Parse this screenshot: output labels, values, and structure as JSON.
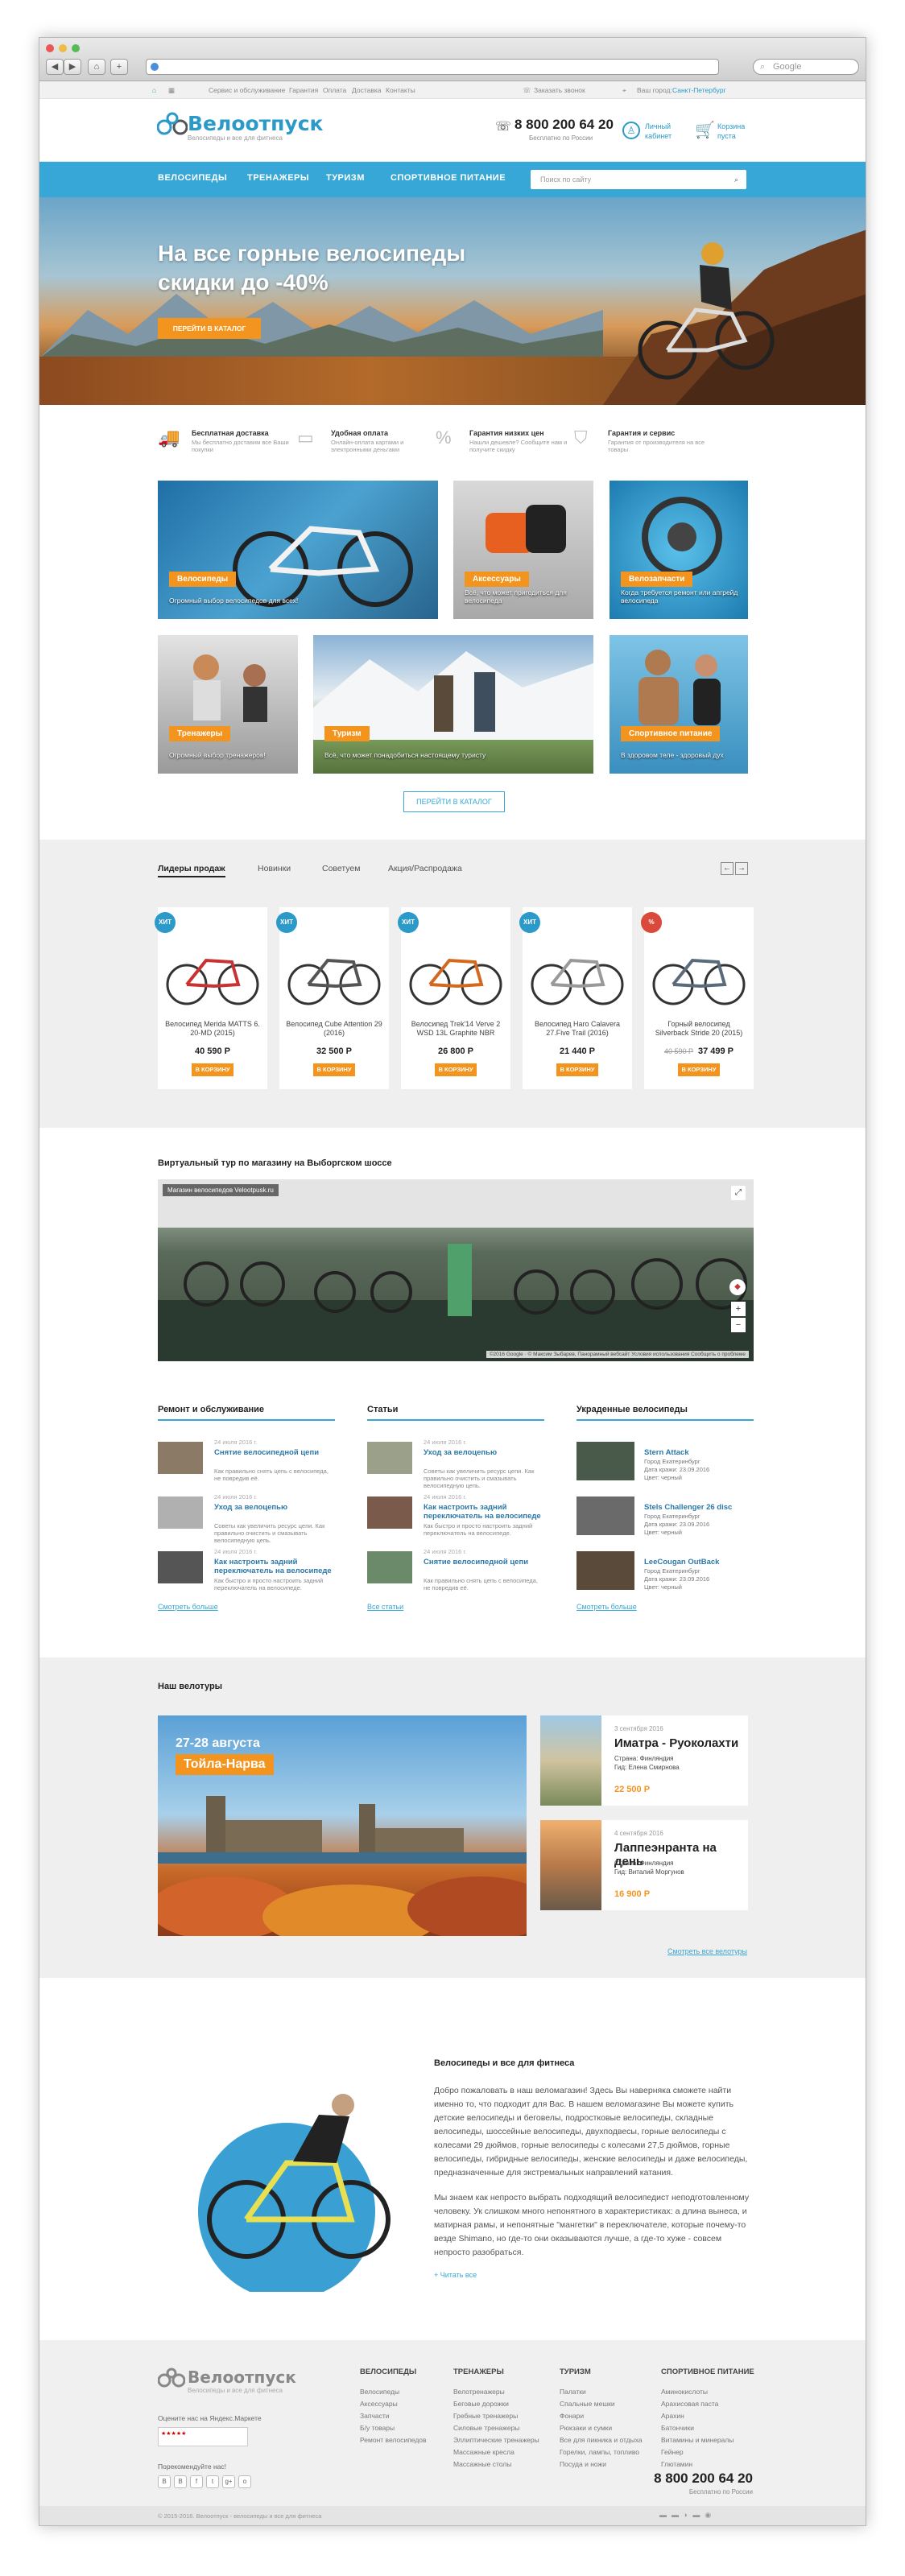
{
  "browser": {
    "search_placeholder": "Google"
  },
  "topbar": {
    "links": [
      "Сервис и обслуживание",
      "Гарантия",
      "Оплата",
      "Доставка",
      "Контакты"
    ],
    "order": "Заказать звонок",
    "city_label": "Ваш город:",
    "city": "Санкт-Петербург"
  },
  "header": {
    "logo": "Велоотпуск",
    "tagline": "Велосипеды и все для фитнеса",
    "phone": "8 800 200 64 20",
    "phone_note": "Бесплатно по России",
    "account_1": "Личный",
    "account_2": "кабинет",
    "cart_1": "Корзина",
    "cart_2": "пуста"
  },
  "menu": {
    "items": [
      "ВЕЛОСИПЕДЫ",
      "ТРЕНАЖЕРЫ",
      "ТУРИЗМ",
      "СПОРТИВНОЕ ПИТАНИЕ"
    ],
    "search_placeholder": "Поиск по сайту"
  },
  "hero": {
    "title": "На все горные велосипеды скидки до -40%",
    "button": "ПЕРЕЙТИ В КАТАЛОГ"
  },
  "features": [
    {
      "title": "Бесплатная доставка",
      "desc": "Мы бесплатно доставим все Ваши покупки"
    },
    {
      "title": "Удобная оплата",
      "desc": "Онлайн-оплата картами и электронными деньгами"
    },
    {
      "title": "Гарантия низких цен",
      "desc": "Нашли дешевле? Сообщите нам и получите скидку"
    },
    {
      "title": "Гарантия и сервис",
      "desc": "Гарантия от производителя на все товары"
    }
  ],
  "categories": [
    {
      "label": "Велосипеды",
      "caption": "Огромный выбор велосипедов для всех!"
    },
    {
      "label": "Аксессуары",
      "caption": "Всё, что может пригодиться для велосипеда"
    },
    {
      "label": "Велозапчасти",
      "caption": "Когда требуется ремонт или апгрейд велосипеда"
    },
    {
      "label": "Тренажеры",
      "caption": "Огромный выбор тренажеров!"
    },
    {
      "label": "Туризм",
      "caption": "Всё, что может понадобиться настоящему туристу"
    },
    {
      "label": "Спортивное питание",
      "caption": "В здоровом теле - здоровый дух"
    }
  ],
  "catalog_button": "ПЕРЕЙТИ В КАТАЛОГ",
  "product_tabs": [
    "Лидеры продаж",
    "Новинки",
    "Советуем",
    "Акция/Распродажа"
  ],
  "products": [
    {
      "badge": "ХИТ",
      "name": "Велосипед Merida MATTS 6. 20-MD (2015)",
      "old": "",
      "price": "40 590 Р",
      "buy": "В КОРЗИНУ",
      "color": "#c93232"
    },
    {
      "badge": "ХИТ",
      "name": "Велосипед Cube Attention 29 (2016)",
      "old": "",
      "price": "32 500 Р",
      "buy": "В КОРЗИНУ",
      "color": "#555"
    },
    {
      "badge": "ХИТ",
      "name": "Велосипед Trek'14 Verve 2 WSD 13L Graphite NBR",
      "old": "",
      "price": "26 800 Р",
      "buy": "В КОРЗИНУ",
      "color": "#d2691e"
    },
    {
      "badge": "ХИТ",
      "name": "Велосипед Haro Calavera 27.Five Trail (2016)",
      "old": "",
      "price": "21 440 Р",
      "buy": "В КОРЗИНУ",
      "color": "#999"
    },
    {
      "badge": "%",
      "name": "Горный велосипед Silverback Stride 20 (2015)",
      "old": "40 590 Р",
      "price": "37 499 Р",
      "buy": "В КОРЗИНУ",
      "color": "#5a6a7a"
    }
  ],
  "tour": {
    "title": "Виртуальный тур по магазину на Выборгском шоссе",
    "overlay": "Магазин велосипедов Velootpusk.ru",
    "footer": "©2016 Google · © Максим Зыбарев, Панорамный вебсайт  Условия использования  Сообщить о проблеме"
  },
  "columns": {
    "repair": {
      "title": "Ремонт и обслуживание",
      "items": [
        {
          "date": "24 июля 2016 г.",
          "title": "Снятие велосипедной цепи",
          "text": "Как правильно снять цепь с велосипеда, не повредив её."
        },
        {
          "date": "24 июля 2016 г.",
          "title": "Уход за велоцепью",
          "text": "Советы как увеличить ресурс цепи. Как правильно очистить и смазывать велосипедную цепь."
        },
        {
          "date": "24 июля 2016 г.",
          "title": "Как настроить задний переключатель на велосипеде",
          "text": "Как быстро и просто настроить задний переключатель на велосипеде."
        }
      ],
      "more": "Смотреть больше"
    },
    "articles": {
      "title": "Статьи",
      "items": [
        {
          "date": "24 июля 2016 г.",
          "title": "Уход за велоцепью",
          "text": "Советы как увеличить ресурс цепи. Как правильно очистить и смазывать велосипедную цепь."
        },
        {
          "date": "24 июля 2016 г.",
          "title": "Как настроить задний переключатель на велосипеде",
          "text": "Как быстро и просто настроить задний переключатель на велосипеде."
        },
        {
          "date": "24 июля 2016 г.",
          "title": "Снятие велосипедной цепи",
          "text": "Как правильно снять цепь с велосипеда, не повредив её."
        }
      ],
      "more": "Все статьи"
    },
    "stolen": {
      "title": "Украденные велосипеды",
      "items": [
        {
          "title": "Stern Attack",
          "l1": "Город Екатеринбург",
          "l2": "Дата кражи: 23.09.2016",
          "l3": "Цвет: черный"
        },
        {
          "title": "Stels Challenger 26 disc",
          "l1": "Город Екатеринбург",
          "l2": "Дата кражи: 23.09.2016",
          "l3": "Цвет: черный"
        },
        {
          "title": "LeeCougan OutBack",
          "l1": "Город Екатеринбург",
          "l2": "Дата кражи: 23.09.2016",
          "l3": "Цвет: черный"
        }
      ],
      "more": "Смотреть больше"
    }
  },
  "tours": {
    "title": "Наш велотуры",
    "banner_date": "27-28 августа",
    "banner_place": "Тойла-Нарва",
    "items": [
      {
        "date": "3 сентября 2016",
        "title": "Иматра - Руоколахти",
        "country": "Страна: Финляндия",
        "guide": "Гид: Елена Смирнова",
        "price": "22 500 Р"
      },
      {
        "date": "4 сентября 2016",
        "title": "Лаппеэнранта на день",
        "country": "Страна: Финляндия",
        "guide": "Гид: Виталий Моргунов",
        "price": "16 900 Р"
      }
    ],
    "more": "Смотреть все велотуры"
  },
  "about": {
    "title": "Велосипеды и все для фитнеса",
    "p1": "Добро пожаловать в наш веломагазин! Здесь Вы наверняка сможете найти именно то, что подходит для Вас. В нашем веломагазине Вы можете купить детские велосипеды и беговелы, подростковые велосипеды, складные велосипеды, шоссейные велосипеды, двухподвесы, горные велосипеды с колесами 29 дюймов, горные велосипеды с колесами 27,5 дюймов, горные велосипеды, гибридные велосипеды, женские велосипеды и даже велосипеды, предназначенные для экстремальных направлений катания.",
    "p2": "Мы знаем как непросто выбрать подходящий велосипедист неподготовленному человеку. Ук слишком много непонятного в характеристиках: а длина вынеса, и матирная рамы, и непонятные \"мангетки\" в переключателе, которые почему-то везде Shimano, но где-то они оказываются лучше, а где-то хуже - совсем непросто разобраться.",
    "more": "+ Читать все"
  },
  "footer": {
    "tagline": "Велосипеды и все для фитнеса",
    "rate": "Оцените нас на Яндекс.Маркете",
    "share": "Порекомендуйте нас!",
    "phone": "8 800 200 64 20",
    "phone_note": "Бесплатно по России",
    "copyright": "© 2015-2016. Велоотпуск - велосипеды и все для фитнеса",
    "cols": [
      {
        "h": "ВЕЛОСИПЕДЫ",
        "items": [
          "Велосипеды",
          "Аксессуары",
          "Запчасти",
          "Б/у товары",
          "Ремонт велосипедов"
        ]
      },
      {
        "h": "ТРЕНАЖЕРЫ",
        "items": [
          "Велотренажеры",
          "Беговые дорожки",
          "Гребные тренажеры",
          "Силовые тренажеры",
          "Эллиптические тренажеры",
          "Массажные кресла",
          "Массажные столы"
        ]
      },
      {
        "h": "ТУРИЗМ",
        "items": [
          "Палатки",
          "Спальные мешки",
          "Фонари",
          "Рюкзаки и сумки",
          "Все для пикника и отдыха",
          "Горелки, лампы, топливо",
          "Посуда и ножи"
        ]
      },
      {
        "h": "СПОРТИВНОЕ ПИТАНИЕ",
        "items": [
          "Аминокислоты",
          "Арахисовая паста",
          "Арахин",
          "Батончики",
          "Витамины и минералы",
          "Гейнер",
          "Глютамин"
        ]
      }
    ]
  }
}
